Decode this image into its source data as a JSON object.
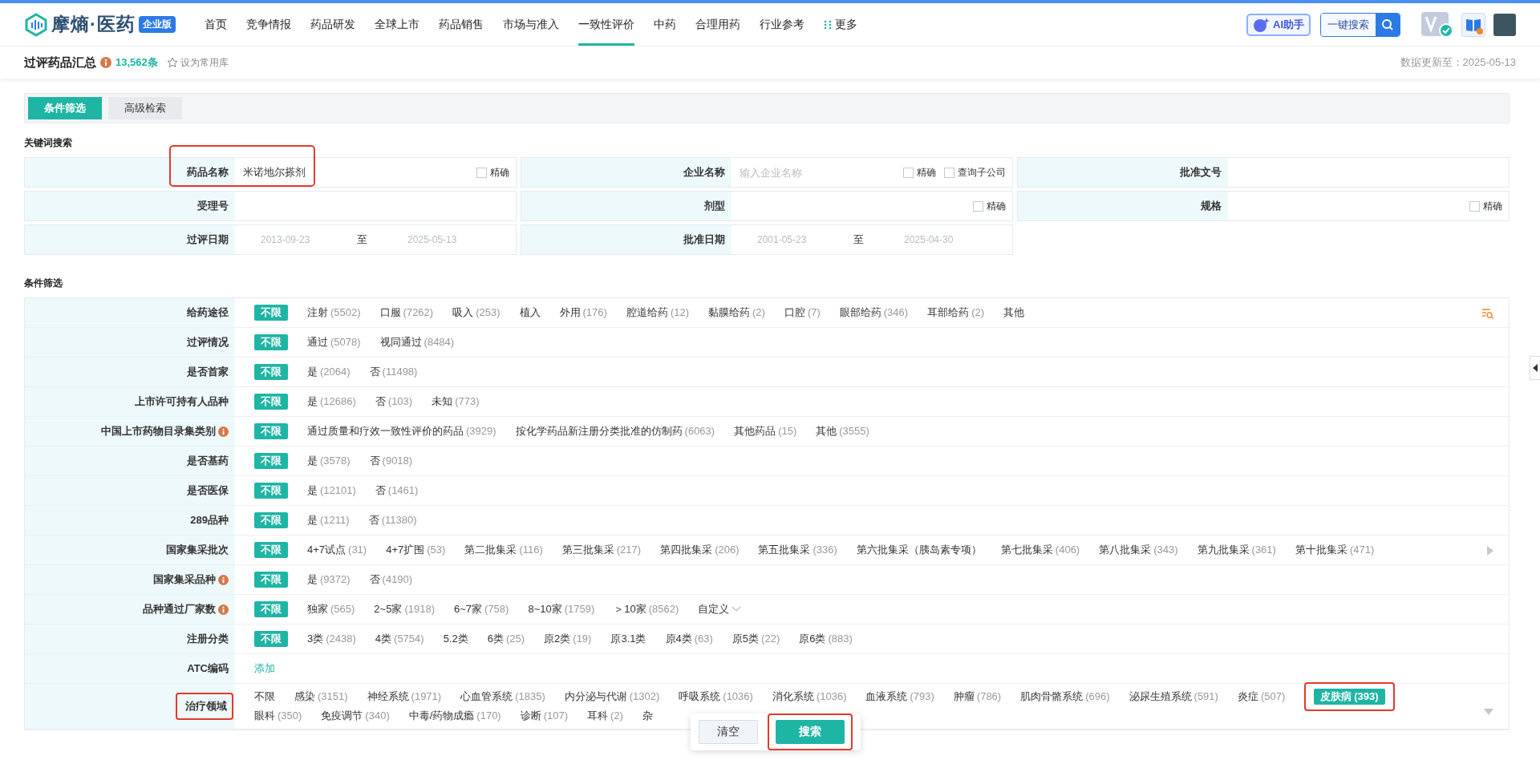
{
  "header": {
    "logo_text": "摩熵·医药",
    "edition_badge": "企业版",
    "nav": [
      {
        "label": "首页",
        "selected": false
      },
      {
        "label": "竞争情报",
        "selected": false
      },
      {
        "label": "药品研发",
        "selected": false
      },
      {
        "label": "全球上市",
        "selected": false
      },
      {
        "label": "药品销售",
        "selected": false
      },
      {
        "label": "市场与准入",
        "selected": false
      },
      {
        "label": "一致性评价",
        "selected": true
      },
      {
        "label": "中药",
        "selected": false
      },
      {
        "label": "合理用药",
        "selected": false
      },
      {
        "label": "行业参考",
        "selected": false
      }
    ],
    "more": "更多",
    "ai_button": "AI助手",
    "search_button": "一键搜索"
  },
  "page": {
    "title": "过评药品汇总",
    "count": "13,562条",
    "favorite": "设为常用库",
    "updated": "数据更新至：2025-05-13"
  },
  "tabs": [
    {
      "label": "条件筛选",
      "selected": true
    },
    {
      "label": "高级检索",
      "selected": false
    }
  ],
  "keyword_section": {
    "title": "关键词搜索",
    "fields": [
      {
        "kind": "text",
        "label": "药品名称",
        "value": "米诺地尔搽剂",
        "highlighted": true,
        "options": [
          {
            "label": "精确",
            "checked": false
          }
        ]
      },
      {
        "kind": "text",
        "label": "企业名称",
        "placeholder": "输入企业名称",
        "highlighted": false,
        "options": [
          {
            "label": "精确",
            "checked": false
          },
          {
            "label": "查询子公司",
            "checked": false
          }
        ]
      },
      {
        "kind": "text",
        "label": "批准文号",
        "highlighted": false
      },
      {
        "kind": "text",
        "label": "受理号",
        "highlighted": false
      },
      {
        "kind": "text",
        "label": "剂型",
        "highlighted": false,
        "options": [
          {
            "label": "精确",
            "checked": false
          }
        ]
      },
      {
        "kind": "text",
        "label": "规格",
        "highlighted": false,
        "options": [
          {
            "label": "精确",
            "checked": false
          }
        ]
      },
      {
        "kind": "range",
        "label": "过评日期",
        "start_placeholder": "2013-09-23",
        "separator": "至",
        "end_placeholder": "2025-05-13",
        "highlighted": false
      },
      {
        "kind": "range",
        "label": "批准日期",
        "start_placeholder": "2001-05-23",
        "separator": "至",
        "end_placeholder": "2025-04-30",
        "highlighted": false
      }
    ]
  },
  "filter_section": {
    "title": "条件筛选",
    "rows": [
      {
        "label": "给药途径",
        "info": false,
        "highlighted": false,
        "tool_icon": true,
        "options": [
          {
            "kind": "option",
            "label": "不限",
            "selected": true
          },
          {
            "kind": "option",
            "label": "注射",
            "count": "(5502)",
            "selected": false
          },
          {
            "kind": "option",
            "label": "口服",
            "count": "(7262)",
            "selected": false
          },
          {
            "kind": "option",
            "label": "吸入",
            "count": "(253)",
            "selected": false
          },
          {
            "kind": "option",
            "label": "植入",
            "selected": false
          },
          {
            "kind": "option",
            "label": "外用",
            "count": "(176)",
            "selected": false
          },
          {
            "kind": "option",
            "label": "腔道给药",
            "count": "(12)",
            "selected": false
          },
          {
            "kind": "option",
            "label": "黏膜给药",
            "count": "(2)",
            "selected": false
          },
          {
            "kind": "option",
            "label": "口腔",
            "count": "(7)",
            "selected": false
          },
          {
            "kind": "option",
            "label": "眼部给药",
            "count": "(346)",
            "selected": false
          },
          {
            "kind": "option",
            "label": "耳部给药",
            "count": "(2)",
            "selected": false
          },
          {
            "kind": "option",
            "label": "其他",
            "selected": false
          }
        ]
      },
      {
        "label": "过评情况",
        "info": false,
        "highlighted": false,
        "options": [
          {
            "kind": "option",
            "label": "不限",
            "selected": true
          },
          {
            "kind": "option",
            "label": "通过",
            "count": "(5078)",
            "selected": false
          },
          {
            "kind": "option",
            "label": "视同通过",
            "count": "(8484)",
            "selected": false
          }
        ]
      },
      {
        "label": "是否首家",
        "info": false,
        "highlighted": false,
        "options": [
          {
            "kind": "option",
            "label": "不限",
            "selected": true
          },
          {
            "kind": "option",
            "label": "是",
            "count": "(2064)",
            "selected": false
          },
          {
            "kind": "option",
            "label": "否",
            "count": "(11498)",
            "selected": false
          }
        ]
      },
      {
        "label": "上市许可持有人品种",
        "info": false,
        "highlighted": false,
        "options": [
          {
            "kind": "option",
            "label": "不限",
            "selected": true
          },
          {
            "kind": "option",
            "label": "是",
            "count": "(12686)",
            "selected": false
          },
          {
            "kind": "option",
            "label": "否",
            "count": "(103)",
            "selected": false
          },
          {
            "kind": "option",
            "label": "未知",
            "count": "(773)",
            "selected": false
          }
        ]
      },
      {
        "label": "中国上市药物目录集类别",
        "info": true,
        "highlighted": false,
        "options": [
          {
            "kind": "option",
            "label": "不限",
            "selected": true
          },
          {
            "kind": "option",
            "label": "通过质量和疗效一致性评价的药品",
            "count": "(3929)",
            "selected": false
          },
          {
            "kind": "option",
            "label": "按化学药品新注册分类批准的仿制药",
            "count": "(6063)",
            "selected": false
          },
          {
            "kind": "option",
            "label": "其他药品",
            "count": "(15)",
            "selected": false
          },
          {
            "kind": "option",
            "label": "其他",
            "count": "(3555)",
            "selected": false
          }
        ]
      },
      {
        "label": "是否基药",
        "info": false,
        "highlighted": false,
        "options": [
          {
            "kind": "option",
            "label": "不限",
            "selected": true
          },
          {
            "kind": "option",
            "label": "是",
            "count": "(3578)",
            "selected": false
          },
          {
            "kind": "option",
            "label": "否",
            "count": "(9018)",
            "selected": false
          }
        ]
      },
      {
        "label": "是否医保",
        "info": false,
        "highlighted": false,
        "options": [
          {
            "kind": "option",
            "label": "不限",
            "selected": true
          },
          {
            "kind": "option",
            "label": "是",
            "count": "(12101)",
            "selected": false
          },
          {
            "kind": "option",
            "label": "否",
            "count": "(1461)",
            "selected": false
          }
        ]
      },
      {
        "label": "289品种",
        "info": false,
        "highlighted": false,
        "options": [
          {
            "kind": "option",
            "label": "不限",
            "selected": true
          },
          {
            "kind": "option",
            "label": "是",
            "count": "(1211)",
            "selected": false
          },
          {
            "kind": "option",
            "label": "否",
            "count": "(11380)",
            "selected": false
          }
        ]
      },
      {
        "label": "国家集采批次",
        "info": false,
        "highlighted": false,
        "scroll_arrow": true,
        "options": [
          {
            "kind": "option",
            "label": "不限",
            "selected": true
          },
          {
            "kind": "option",
            "label": "4+7试点",
            "count": "(31)",
            "selected": false
          },
          {
            "kind": "option",
            "label": "4+7扩围",
            "count": "(53)",
            "selected": false
          },
          {
            "kind": "option",
            "label": "第二批集采",
            "count": "(116)",
            "selected": false
          },
          {
            "kind": "option",
            "label": "第三批集采",
            "count": "(217)",
            "selected": false
          },
          {
            "kind": "option",
            "label": "第四批集采",
            "count": "(206)",
            "selected": false
          },
          {
            "kind": "option",
            "label": "第五批集采",
            "count": "(336)",
            "selected": false
          },
          {
            "kind": "option",
            "label": "第六批集采（胰岛素专项）",
            "selected": false
          },
          {
            "kind": "option",
            "label": "第七批集采",
            "count": "(406)",
            "selected": false
          },
          {
            "kind": "option",
            "label": "第八批集采",
            "count": "(343)",
            "selected": false
          },
          {
            "kind": "option",
            "label": "第九批集采",
            "count": "(361)",
            "selected": false
          },
          {
            "kind": "option",
            "label": "第十批集采",
            "count": "(471)",
            "selected": false
          }
        ]
      },
      {
        "label": "国家集采品种",
        "info": true,
        "highlighted": false,
        "options": [
          {
            "kind": "option",
            "label": "不限",
            "selected": true
          },
          {
            "kind": "option",
            "label": "是",
            "count": "(9372)",
            "selected": false
          },
          {
            "kind": "option",
            "label": "否",
            "count": "(4190)",
            "selected": false
          }
        ]
      },
      {
        "label": "品种通过厂家数",
        "info": true,
        "highlighted": false,
        "options": [
          {
            "kind": "option",
            "label": "不限",
            "selected": true
          },
          {
            "kind": "option",
            "label": "独家",
            "count": "(565)",
            "selected": false
          },
          {
            "kind": "option",
            "label": "2~5家",
            "count": "(1918)",
            "selected": false
          },
          {
            "kind": "option",
            "label": "6~7家",
            "count": "(758)",
            "selected": false
          },
          {
            "kind": "option",
            "label": "8~10家",
            "count": "(1759)",
            "selected": false
          },
          {
            "kind": "option",
            "label": "＞10家",
            "count": "(8562)",
            "selected": false
          },
          {
            "kind": "dropdown",
            "label": "自定义"
          }
        ]
      },
      {
        "label": "注册分类",
        "info": false,
        "highlighted": false,
        "options": [
          {
            "kind": "option",
            "label": "不限",
            "selected": true
          },
          {
            "kind": "option",
            "label": "3类",
            "count": "(2438)",
            "selected": false
          },
          {
            "kind": "option",
            "label": "4类",
            "count": "(5754)",
            "selected": false
          },
          {
            "kind": "option",
            "label": "5.2类",
            "selected": false
          },
          {
            "kind": "option",
            "label": "6类",
            "count": "(25)",
            "selected": false
          },
          {
            "kind": "option",
            "label": "原2类",
            "count": "(19)",
            "selected": false
          },
          {
            "kind": "option",
            "label": "原3.1类",
            "selected": false
          },
          {
            "kind": "option",
            "label": "原4类",
            "count": "(63)",
            "selected": false
          },
          {
            "kind": "option",
            "label": "原5类",
            "count": "(22)",
            "selected": false
          },
          {
            "kind": "option",
            "label": "原6类",
            "count": "(883)",
            "selected": false
          }
        ]
      },
      {
        "label": "ATC编码",
        "info": false,
        "highlighted": false,
        "options": [
          {
            "kind": "link",
            "label": "添加"
          }
        ]
      },
      {
        "label": "治疗领域",
        "info": false,
        "highlighted": true,
        "expand_arrow": true,
        "options": [
          {
            "kind": "option",
            "label": "不限",
            "selected": false
          },
          {
            "kind": "option",
            "label": "感染",
            "count": "(3151)",
            "selected": false
          },
          {
            "kind": "option",
            "label": "神经系统",
            "count": "(1971)",
            "selected": false
          },
          {
            "kind": "option",
            "label": "心血管系统",
            "count": "(1835)",
            "selected": false
          },
          {
            "kind": "option",
            "label": "内分泌与代谢",
            "count": "(1302)",
            "selected": false
          },
          {
            "kind": "option",
            "label": "呼吸系统",
            "count": "(1036)",
            "selected": false
          },
          {
            "kind": "option",
            "label": "消化系统",
            "count": "(1036)",
            "selected": false
          },
          {
            "kind": "option",
            "label": "血液系统",
            "count": "(793)",
            "selected": false
          },
          {
            "kind": "option",
            "label": "肿瘤",
            "count": "(786)",
            "selected": false
          },
          {
            "kind": "option",
            "label": "肌肉骨骼系统",
            "count": "(696)",
            "selected": false
          },
          {
            "kind": "option",
            "label": "泌尿生殖系统",
            "count": "(591)",
            "selected": false
          },
          {
            "kind": "option",
            "label": "炎症",
            "count": "(507)",
            "selected": false
          },
          {
            "kind": "option",
            "label": "皮肤病",
            "count": "(393)",
            "selected": true,
            "highlighted": true
          },
          {
            "kind": "option",
            "label": "眼科",
            "count": "(350)",
            "selected": false
          },
          {
            "kind": "option",
            "label": "免疫调节",
            "count": "(340)",
            "selected": false
          },
          {
            "kind": "option",
            "label": "中毒/药物成瘾",
            "count": "(170)",
            "selected": false
          },
          {
            "kind": "option",
            "label": "诊断",
            "count": "(107)",
            "selected": false
          },
          {
            "kind": "option",
            "label": "耳科",
            "count": "(2)",
            "selected": false
          },
          {
            "kind": "option",
            "label": "杂",
            "selected": false
          }
        ]
      }
    ]
  },
  "popover": {
    "buttons": [
      {
        "kind": "secondary",
        "label": "清空",
        "highlighted": false
      },
      {
        "kind": "primary",
        "label": "搜索",
        "highlighted": true
      }
    ]
  }
}
